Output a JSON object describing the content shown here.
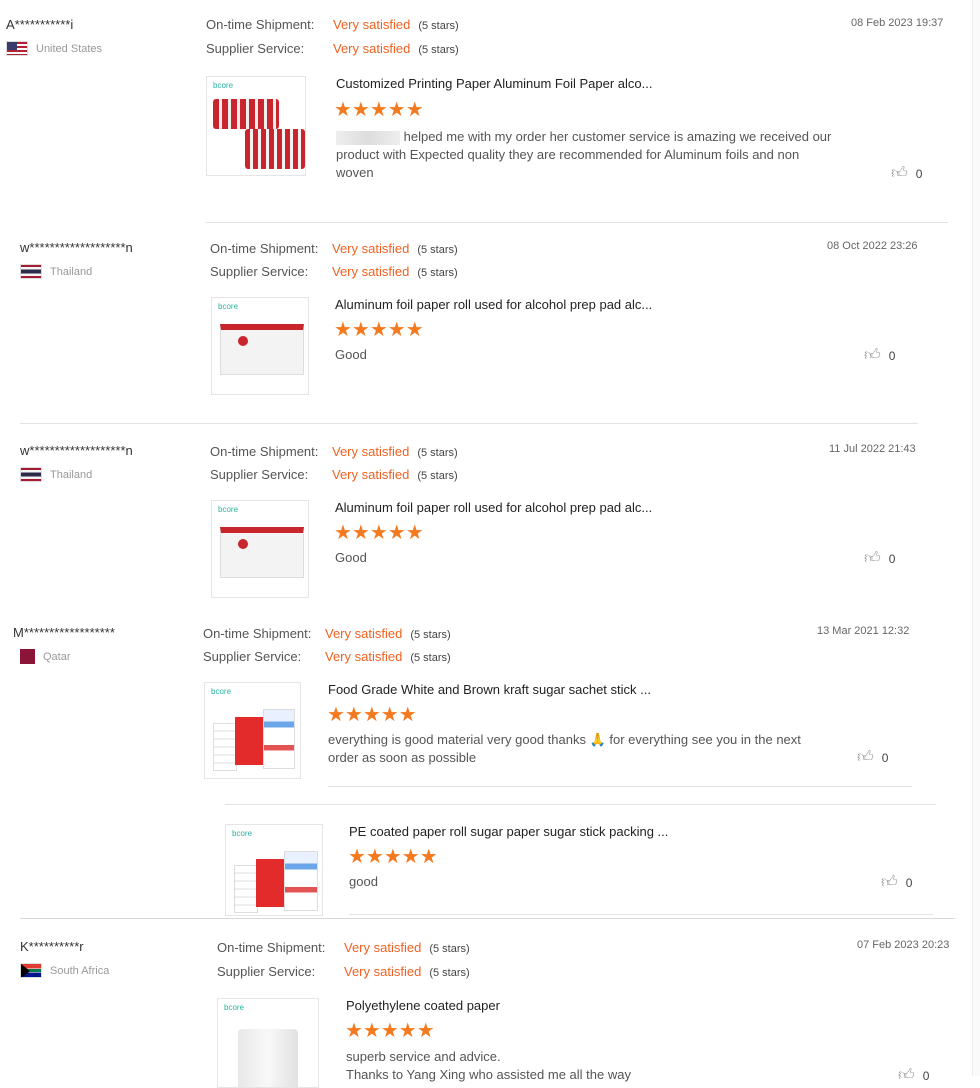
{
  "labels": {
    "shipment": "On-time Shipment:",
    "service": "Supplier Service:"
  },
  "reviews": [
    {
      "user": "A***********i",
      "country": "United States",
      "shipment_value": "Very satisfied",
      "shipment_stars": "(5 stars)",
      "service_value": "Very satisfied",
      "service_stars": "(5 stars)",
      "date": "08 Feb 2023 19:37",
      "product_title": "Customized Printing Paper Aluminum Foil Paper alco...",
      "stars": "★★★★★",
      "text": "helped me with my order her customer service is amazing we received our product with Expected quality they are recommended for Aluminum foils and non woven",
      "likes": "0"
    },
    {
      "user": "w*******************n",
      "country": "Thailand",
      "shipment_value": "Very satisfied",
      "shipment_stars": "(5 stars)",
      "service_value": "Very satisfied",
      "service_stars": "(5 stars)",
      "date": "08 Oct 2022 23:26",
      "product_title": "Aluminum foil paper roll used for alcohol prep pad alc...",
      "stars": "★★★★★",
      "text": "Good",
      "likes": "0"
    },
    {
      "user": "w*******************n",
      "country": "Thailand",
      "shipment_value": "Very satisfied",
      "shipment_stars": "(5 stars)",
      "service_value": "Very satisfied",
      "service_stars": "(5 stars)",
      "date": "11 Jul 2022 21:43",
      "product_title": "Aluminum foil paper roll used for alcohol prep pad alc...",
      "stars": "★★★★★",
      "text": "Good",
      "likes": "0"
    },
    {
      "user": "M******************",
      "country": "Qatar",
      "shipment_value": "Very satisfied",
      "shipment_stars": "(5 stars)",
      "service_value": "Very satisfied",
      "service_stars": "(5 stars)",
      "date": "13 Mar 2021 12:32",
      "product_title": "Food Grade White and Brown kraft sugar sachet stick ...",
      "stars": "★★★★★",
      "text": "everything is good material very good thanks 🙏 for everything see you in the next order as soon as possible",
      "likes": "0",
      "product2_title": "PE coated paper roll sugar paper sugar stick packing ...",
      "product2_stars": "★★★★★",
      "product2_text": "good",
      "product2_likes": "0"
    },
    {
      "user": "K**********r",
      "country": "South Africa",
      "shipment_value": "Very satisfied",
      "shipment_stars": "(5 stars)",
      "service_value": "Very satisfied",
      "service_stars": "(5 stars)",
      "date": "07 Feb 2023 20:23",
      "product_title": "Polyethylene coated paper",
      "stars": "★★★★★",
      "text": "superb service and advice.",
      "text2": "Thanks to Yang Xing who assisted me all the way",
      "likes": "0"
    }
  ],
  "brand": "bcore",
  "icons": {
    "like": "thumbs-up-icon"
  },
  "colors": {
    "accent": "#f06121",
    "star": "#f5791f"
  }
}
